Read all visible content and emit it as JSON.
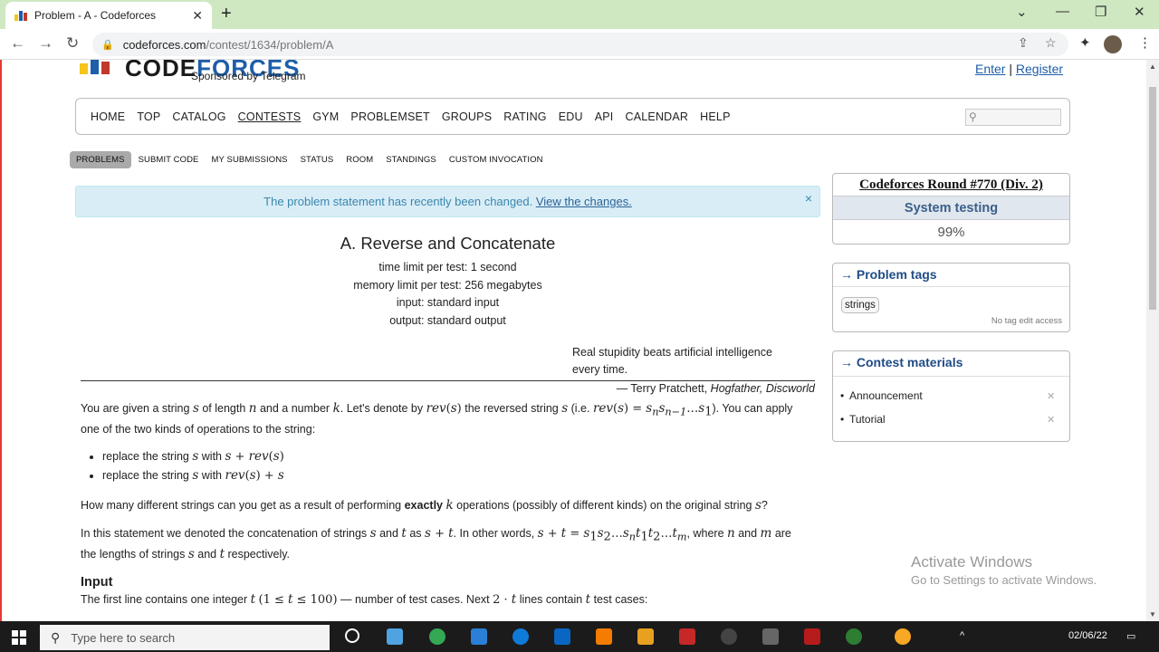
{
  "browser": {
    "tab_title": "Problem - A - Codeforces",
    "tab_close": "✕",
    "new_tab": "+",
    "url_domain": "codeforces.com",
    "url_path": "/contest/1634/problem/A"
  },
  "site": {
    "logo_code": "CODE",
    "logo_forces": "FORCES",
    "sponsor": "Sponsored by Telegram",
    "enter": "Enter",
    "sep": "|",
    "register": "Register"
  },
  "menu": [
    "HOME",
    "TOP",
    "CATALOG",
    "CONTESTS",
    "GYM",
    "PROBLEMSET",
    "GROUPS",
    "RATING",
    "EDU",
    "API",
    "CALENDAR",
    "HELP"
  ],
  "menu_active": "CONTESTS",
  "subnav": [
    "PROBLEMS",
    "SUBMIT CODE",
    "MY SUBMISSIONS",
    "STATUS",
    "ROOM",
    "STANDINGS",
    "CUSTOM INVOCATION"
  ],
  "alert": {
    "text": "The problem statement has recently been changed.",
    "link": "View the changes.",
    "close": "×"
  },
  "problem": {
    "title": "A. Reverse and Concatenate",
    "time_limit": "time limit per test: 1 second",
    "memory_limit": "memory limit per test: 256 megabytes",
    "input": "input: standard input",
    "output": "output: standard output",
    "epigraph_line1": "Real stupidity beats artificial intelligence",
    "epigraph_line2": "every time.",
    "author_prefix": "— Terry Pratchett,",
    "author_books": "Hogfather, Discworld",
    "input_heading": "Input"
  },
  "sidebar": {
    "round_name": "Codeforces Round #770 (Div. 2)",
    "phase": "System testing",
    "percent": "99%",
    "tags_title": "→ Problem tags",
    "tag": "strings",
    "tag_note": "No tag edit access",
    "materials_title": "→ Contest materials",
    "materials": [
      "Announcement",
      "Tutorial"
    ]
  },
  "watermark": {
    "line1": "Activate Windows",
    "line2": "Go to Settings to activate Windows."
  },
  "taskbar": {
    "search_placeholder": "Type here to search",
    "date": "02/06/22"
  },
  "colors": {
    "tab_strip": "#cfe8c2",
    "accent_blue": "#1f5ea8",
    "alert_bg": "#d9edf7"
  }
}
